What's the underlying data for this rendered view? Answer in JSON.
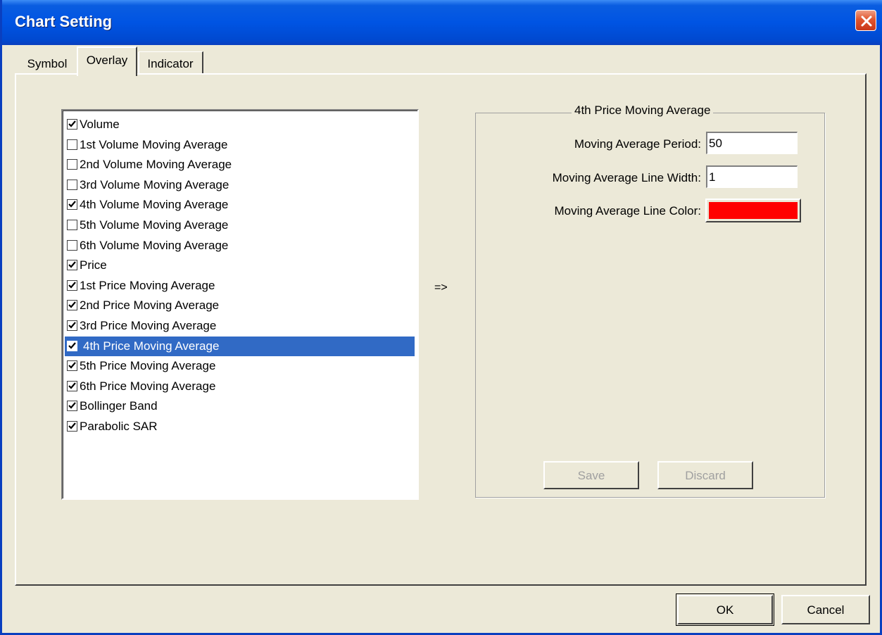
{
  "window": {
    "title": "Chart Setting"
  },
  "tabs": [
    {
      "label": "Symbol",
      "active": false
    },
    {
      "label": "Overlay",
      "active": true
    },
    {
      "label": "Indicator",
      "active": false
    }
  ],
  "overlay_list": {
    "items": [
      {
        "label": "Volume",
        "checked": true
      },
      {
        "label": "1st Volume Moving Average",
        "checked": false
      },
      {
        "label": "2nd Volume Moving Average",
        "checked": false
      },
      {
        "label": "3rd Volume Moving Average",
        "checked": false
      },
      {
        "label": "4th Volume Moving Average",
        "checked": true
      },
      {
        "label": "5th Volume Moving Average",
        "checked": false
      },
      {
        "label": "6th Volume Moving Average",
        "checked": false
      },
      {
        "label": "Price",
        "checked": true
      },
      {
        "label": "1st Price Moving Average",
        "checked": true
      },
      {
        "label": "2nd Price Moving Average",
        "checked": true
      },
      {
        "label": "3rd Price Moving Average",
        "checked": true
      },
      {
        "label": "4th Price Moving Average",
        "checked": true,
        "selected": true
      },
      {
        "label": "5th Price Moving Average",
        "checked": true
      },
      {
        "label": "6th Price Moving Average",
        "checked": true
      },
      {
        "label": "Bollinger Band",
        "checked": true
      },
      {
        "label": "Parabolic SAR",
        "checked": true
      }
    ]
  },
  "arrow_label": "=>",
  "settings": {
    "group_title": "4th Price Moving Average",
    "period_label": "Moving Average Period:",
    "period_value": "50",
    "width_label": "Moving Average Line Width:",
    "width_value": "1",
    "color_label": "Moving Average Line Color:",
    "line_color": "#ff0000",
    "save_label": "Save",
    "discard_label": "Discard"
  },
  "footer": {
    "ok_label": "OK",
    "cancel_label": "Cancel"
  },
  "icons": {
    "close": "close-icon",
    "check": "check-icon"
  }
}
